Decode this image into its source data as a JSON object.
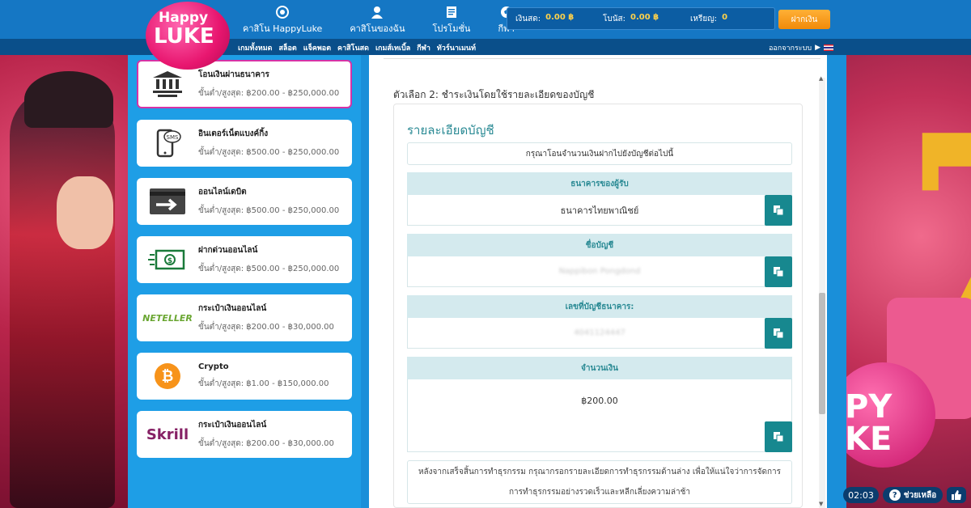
{
  "brand": {
    "line1": "Happy",
    "line2": "LUKE"
  },
  "nav": [
    {
      "label": "คาสิโน HappyLuke",
      "icon": "casino-chip-icon"
    },
    {
      "label": "คาสิโนของฉัน",
      "icon": "user-icon"
    },
    {
      "label": "โปรโมชั่น",
      "icon": "promotion-document-icon"
    },
    {
      "label": "กีฬา",
      "icon": "soccer-ball-icon"
    }
  ],
  "wallet": {
    "cash_label": "เงินสด:",
    "cash_value": "0.00 ฿",
    "bonus_label": "โบนัส:",
    "bonus_value": "0.00 ฿",
    "coins_label": "เหรียญ:",
    "coins_value": "0"
  },
  "deposit_button": "ฝากเงิน",
  "subnav": [
    "เกมทั้งหมด",
    "สล็อต",
    "แจ็คพอต",
    "คาสิโนสด",
    "เกมส์เทเบิ้ล",
    "กีฬา",
    "ทัวร์นาเมนท์"
  ],
  "logout": "ออกจากระบบ",
  "methods": [
    {
      "title": "โอนเงินผ่านธนาคาร",
      "range": "ขั้นต่ำ/สูงสุด: ฿200.00 - ฿250,000.00",
      "icon": "bank-icon",
      "active": true
    },
    {
      "title": "อินเตอร์เน็ตแบงค์กิ้ง",
      "range": "ขั้นต่ำ/สูงสุด: ฿500.00 - ฿250,000.00",
      "icon": "sms-phone-icon"
    },
    {
      "title": "ออนไลน์เดบิต",
      "range": "ขั้นต่ำ/สูงสุด: ฿500.00 - ฿250,000.00",
      "icon": "debit-card-arrow-icon"
    },
    {
      "title": "ฝากด่วนออนไลน์",
      "range": "ขั้นต่ำ/สูงสุด: ฿500.00 - ฿250,000.00",
      "icon": "fast-cash-icon"
    },
    {
      "title": "กระเป๋าเงินออนไลน์",
      "range": "ขั้นต่ำ/สูงสุด: ฿200.00 - ฿30,000.00",
      "icon": "neteller-logo",
      "logo_text": "NETELLER"
    },
    {
      "title": "Crypto",
      "range": "ขั้นต่ำ/สูงสุด: ฿1.00 - ฿150,000.00",
      "icon": "bitcoin-icon"
    },
    {
      "title": "กระเป๋าเงินออนไลน์",
      "range": "ขั้นต่ำ/สูงสุด: ฿200.00 - ฿30,000.00",
      "icon": "skrill-logo",
      "logo_text": "Skrill"
    }
  ],
  "content": {
    "option_title": "ตัวเลือก 2: ชำระเงินโดยใช้รายละเอียดของบัญชี",
    "card_title": "รายละเอียดบัญชี",
    "notice": "กรุณาโอนจำนวนเงินฝากไปยังบัญชีต่อไปนี้",
    "bank_label": "ธนาคารของผู้รับ",
    "bank_value": "ธนาคารไทยพาณิชย์",
    "name_label": "ชื่อบัญชี",
    "name_value": "Nappibon Pongdond",
    "number_label": "เลขที่บัญชีธนาคาร:",
    "number_value": "4041124447",
    "amount_label": "จำนวนเงิน",
    "amount_value": "฿200.00",
    "post_note_line1": "หลังจากเสร็จสิ้นการทำธุรกรรม กรุณากรอกรายละเอียดการทำธุรกรรมด้านล่าง เพื่อให้แน่ใจว่าการจัดการ",
    "post_note_line2": "การทำธุรกรรมอย่างรวดเร็วและหลีกเลี่ยงความล่าช้า"
  },
  "widgets": {
    "timer": "02:03",
    "help": "ช่วยเหลือ"
  },
  "colors": {
    "accent": "#17888f",
    "header": "#1577c4",
    "panel": "#1e9ee6",
    "active_border": "#d633a6",
    "deposit": "#f29a1c"
  }
}
